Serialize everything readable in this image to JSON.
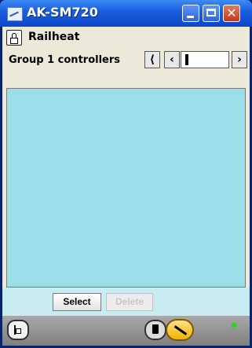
{
  "window": {
    "title": "AK-SM720",
    "accent": "#1c5fe0",
    "controls": [
      "minimize-icon",
      "maximize-icon",
      "close-icon"
    ]
  },
  "header": {
    "lock_icon": "lock-icon",
    "name": "Railheat"
  },
  "group": {
    "label": "Group 1 controllers",
    "nav": {
      "first": "|<",
      "prev": "<",
      "next": ">"
    }
  },
  "list": {
    "background": "#9adfe8",
    "items": []
  },
  "actions": {
    "select_label": "Select",
    "delete_label": "Delete",
    "delete_enabled": false
  },
  "statusbar": {
    "tree_icon": "tree-icon",
    "notes_icon": "notes-icon",
    "tool_icon": "wrench-icon",
    "led_color": "#33cc22"
  }
}
